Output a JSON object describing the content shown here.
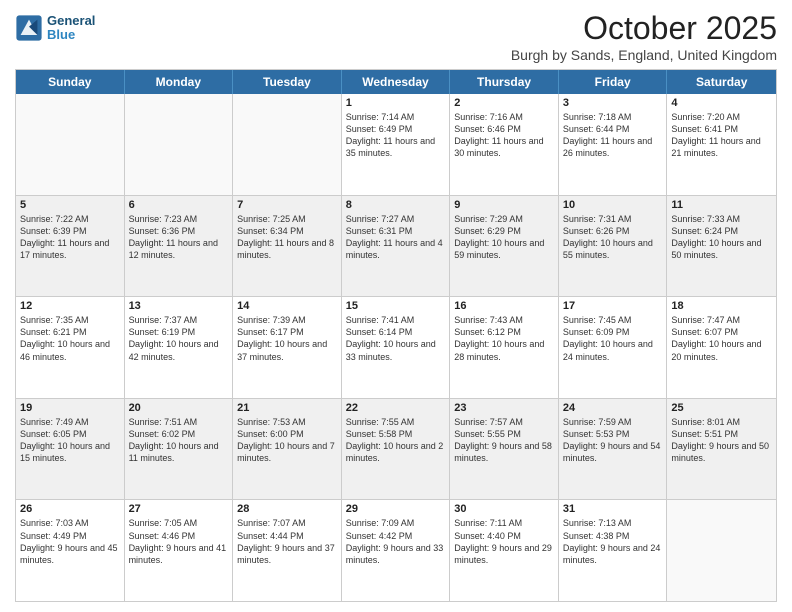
{
  "header": {
    "logo_line1": "General",
    "logo_line2": "Blue",
    "month_title": "October 2025",
    "location": "Burgh by Sands, England, United Kingdom"
  },
  "days_of_week": [
    "Sunday",
    "Monday",
    "Tuesday",
    "Wednesday",
    "Thursday",
    "Friday",
    "Saturday"
  ],
  "rows": [
    [
      {
        "day": "",
        "text": "",
        "empty": true
      },
      {
        "day": "",
        "text": "",
        "empty": true
      },
      {
        "day": "",
        "text": "",
        "empty": true
      },
      {
        "day": "1",
        "text": "Sunrise: 7:14 AM\nSunset: 6:49 PM\nDaylight: 11 hours and 35 minutes.",
        "empty": false
      },
      {
        "day": "2",
        "text": "Sunrise: 7:16 AM\nSunset: 6:46 PM\nDaylight: 11 hours and 30 minutes.",
        "empty": false
      },
      {
        "day": "3",
        "text": "Sunrise: 7:18 AM\nSunset: 6:44 PM\nDaylight: 11 hours and 26 minutes.",
        "empty": false
      },
      {
        "day": "4",
        "text": "Sunrise: 7:20 AM\nSunset: 6:41 PM\nDaylight: 11 hours and 21 minutes.",
        "empty": false
      }
    ],
    [
      {
        "day": "5",
        "text": "Sunrise: 7:22 AM\nSunset: 6:39 PM\nDaylight: 11 hours and 17 minutes.",
        "empty": false
      },
      {
        "day": "6",
        "text": "Sunrise: 7:23 AM\nSunset: 6:36 PM\nDaylight: 11 hours and 12 minutes.",
        "empty": false
      },
      {
        "day": "7",
        "text": "Sunrise: 7:25 AM\nSunset: 6:34 PM\nDaylight: 11 hours and 8 minutes.",
        "empty": false
      },
      {
        "day": "8",
        "text": "Sunrise: 7:27 AM\nSunset: 6:31 PM\nDaylight: 11 hours and 4 minutes.",
        "empty": false
      },
      {
        "day": "9",
        "text": "Sunrise: 7:29 AM\nSunset: 6:29 PM\nDaylight: 10 hours and 59 minutes.",
        "empty": false
      },
      {
        "day": "10",
        "text": "Sunrise: 7:31 AM\nSunset: 6:26 PM\nDaylight: 10 hours and 55 minutes.",
        "empty": false
      },
      {
        "day": "11",
        "text": "Sunrise: 7:33 AM\nSunset: 6:24 PM\nDaylight: 10 hours and 50 minutes.",
        "empty": false
      }
    ],
    [
      {
        "day": "12",
        "text": "Sunrise: 7:35 AM\nSunset: 6:21 PM\nDaylight: 10 hours and 46 minutes.",
        "empty": false
      },
      {
        "day": "13",
        "text": "Sunrise: 7:37 AM\nSunset: 6:19 PM\nDaylight: 10 hours and 42 minutes.",
        "empty": false
      },
      {
        "day": "14",
        "text": "Sunrise: 7:39 AM\nSunset: 6:17 PM\nDaylight: 10 hours and 37 minutes.",
        "empty": false
      },
      {
        "day": "15",
        "text": "Sunrise: 7:41 AM\nSunset: 6:14 PM\nDaylight: 10 hours and 33 minutes.",
        "empty": false
      },
      {
        "day": "16",
        "text": "Sunrise: 7:43 AM\nSunset: 6:12 PM\nDaylight: 10 hours and 28 minutes.",
        "empty": false
      },
      {
        "day": "17",
        "text": "Sunrise: 7:45 AM\nSunset: 6:09 PM\nDaylight: 10 hours and 24 minutes.",
        "empty": false
      },
      {
        "day": "18",
        "text": "Sunrise: 7:47 AM\nSunset: 6:07 PM\nDaylight: 10 hours and 20 minutes.",
        "empty": false
      }
    ],
    [
      {
        "day": "19",
        "text": "Sunrise: 7:49 AM\nSunset: 6:05 PM\nDaylight: 10 hours and 15 minutes.",
        "empty": false
      },
      {
        "day": "20",
        "text": "Sunrise: 7:51 AM\nSunset: 6:02 PM\nDaylight: 10 hours and 11 minutes.",
        "empty": false
      },
      {
        "day": "21",
        "text": "Sunrise: 7:53 AM\nSunset: 6:00 PM\nDaylight: 10 hours and 7 minutes.",
        "empty": false
      },
      {
        "day": "22",
        "text": "Sunrise: 7:55 AM\nSunset: 5:58 PM\nDaylight: 10 hours and 2 minutes.",
        "empty": false
      },
      {
        "day": "23",
        "text": "Sunrise: 7:57 AM\nSunset: 5:55 PM\nDaylight: 9 hours and 58 minutes.",
        "empty": false
      },
      {
        "day": "24",
        "text": "Sunrise: 7:59 AM\nSunset: 5:53 PM\nDaylight: 9 hours and 54 minutes.",
        "empty": false
      },
      {
        "day": "25",
        "text": "Sunrise: 8:01 AM\nSunset: 5:51 PM\nDaylight: 9 hours and 50 minutes.",
        "empty": false
      }
    ],
    [
      {
        "day": "26",
        "text": "Sunrise: 7:03 AM\nSunset: 4:49 PM\nDaylight: 9 hours and 45 minutes.",
        "empty": false
      },
      {
        "day": "27",
        "text": "Sunrise: 7:05 AM\nSunset: 4:46 PM\nDaylight: 9 hours and 41 minutes.",
        "empty": false
      },
      {
        "day": "28",
        "text": "Sunrise: 7:07 AM\nSunset: 4:44 PM\nDaylight: 9 hours and 37 minutes.",
        "empty": false
      },
      {
        "day": "29",
        "text": "Sunrise: 7:09 AM\nSunset: 4:42 PM\nDaylight: 9 hours and 33 minutes.",
        "empty": false
      },
      {
        "day": "30",
        "text": "Sunrise: 7:11 AM\nSunset: 4:40 PM\nDaylight: 9 hours and 29 minutes.",
        "empty": false
      },
      {
        "day": "31",
        "text": "Sunrise: 7:13 AM\nSunset: 4:38 PM\nDaylight: 9 hours and 24 minutes.",
        "empty": false
      },
      {
        "day": "",
        "text": "",
        "empty": true
      }
    ]
  ]
}
